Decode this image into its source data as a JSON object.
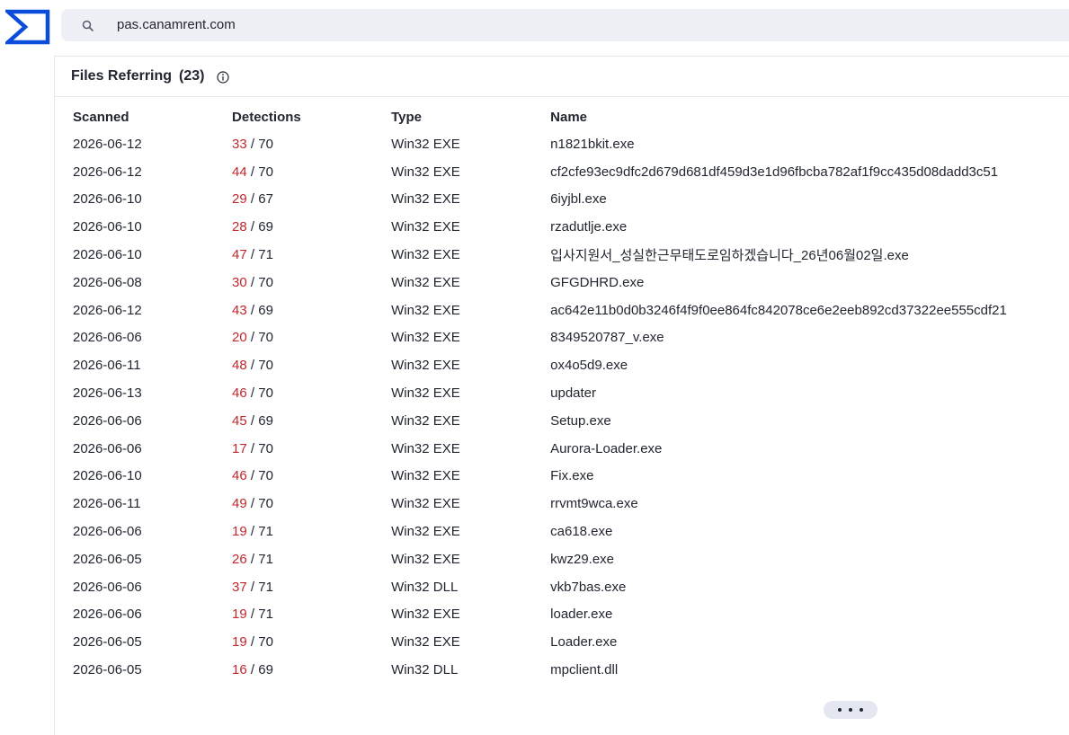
{
  "header": {
    "logo_icon": "virustotal-sigma-logo",
    "brand_color": "#0b4dda",
    "search_icon": "search-icon",
    "search_value": "pas.canamrent.com"
  },
  "section": {
    "title": "Files Referring",
    "count": "(23)",
    "info_icon": "info-icon"
  },
  "table": {
    "columns": [
      "Scanned",
      "Detections",
      "Type",
      "Name"
    ],
    "rows": [
      {
        "scanned": "2026-06-12",
        "positives": "33",
        "total": " / 70",
        "type": "Win32 EXE",
        "name": "n1821bkit.exe"
      },
      {
        "scanned": "2026-06-12",
        "positives": "44",
        "total": " / 70",
        "type": "Win32 EXE",
        "name": "cf2cfe93ec9dfc2d679d681df459d3e1d96fbcba782af1f9cc435d08dadd3c51"
      },
      {
        "scanned": "2026-06-10",
        "positives": "29",
        "total": " / 67",
        "type": "Win32 EXE",
        "name": "6iyjbl.exe"
      },
      {
        "scanned": "2026-06-10",
        "positives": "28",
        "total": " / 69",
        "type": "Win32 EXE",
        "name": "rzadutlje.exe"
      },
      {
        "scanned": "2026-06-10",
        "positives": "47",
        "total": " / 71",
        "type": "Win32 EXE",
        "name": "입사지원서_성실한근무태도로임하겠습니다_26년06월02일.exe"
      },
      {
        "scanned": "2026-06-08",
        "positives": "30",
        "total": " / 70",
        "type": "Win32 EXE",
        "name": "GFGDHRD.exe"
      },
      {
        "scanned": "2026-06-12",
        "positives": "43",
        "total": " / 69",
        "type": "Win32 EXE",
        "name": "ac642e11b0d0b3246f4f9f0ee864fc842078ce6e2eeb892cd37322ee555cdf21"
      },
      {
        "scanned": "2026-06-06",
        "positives": "20",
        "total": " / 70",
        "type": "Win32 EXE",
        "name": "8349520787_v.exe"
      },
      {
        "scanned": "2026-06-11",
        "positives": "48",
        "total": " / 70",
        "type": "Win32 EXE",
        "name": "ox4o5d9.exe"
      },
      {
        "scanned": "2026-06-13",
        "positives": "46",
        "total": " / 70",
        "type": "Win32 EXE",
        "name": "updater"
      },
      {
        "scanned": "2026-06-06",
        "positives": "45",
        "total": " / 69",
        "type": "Win32 EXE",
        "name": "Setup.exe"
      },
      {
        "scanned": "2026-06-06",
        "positives": "17",
        "total": " / 70",
        "type": "Win32 EXE",
        "name": "Aurora-Loader.exe"
      },
      {
        "scanned": "2026-06-10",
        "positives": "46",
        "total": " / 70",
        "type": "Win32 EXE",
        "name": "Fix.exe"
      },
      {
        "scanned": "2026-06-11",
        "positives": "49",
        "total": " / 70",
        "type": "Win32 EXE",
        "name": "rrvmt9wca.exe"
      },
      {
        "scanned": "2026-06-06",
        "positives": "19",
        "total": " / 71",
        "type": "Win32 EXE",
        "name": "ca618.exe"
      },
      {
        "scanned": "2026-06-05",
        "positives": "26",
        "total": " / 71",
        "type": "Win32 EXE",
        "name": "kwz29.exe"
      },
      {
        "scanned": "2026-06-06",
        "positives": "37",
        "total": " / 71",
        "type": "Win32 DLL",
        "name": "vkb7bas.exe"
      },
      {
        "scanned": "2026-06-06",
        "positives": "19",
        "total": " / 71",
        "type": "Win32 EXE",
        "name": "loader.exe"
      },
      {
        "scanned": "2026-06-05",
        "positives": "19",
        "total": " / 70",
        "type": "Win32 EXE",
        "name": "Loader.exe"
      },
      {
        "scanned": "2026-06-05",
        "positives": "16",
        "total": " / 69",
        "type": "Win32 DLL",
        "name": "mpclient.dll"
      }
    ]
  },
  "more_button": {
    "icon": "more-dots-icon"
  },
  "colors": {
    "positive_detections": "#c0282d",
    "text": "#222631",
    "search_bg": "#eef0f6"
  }
}
